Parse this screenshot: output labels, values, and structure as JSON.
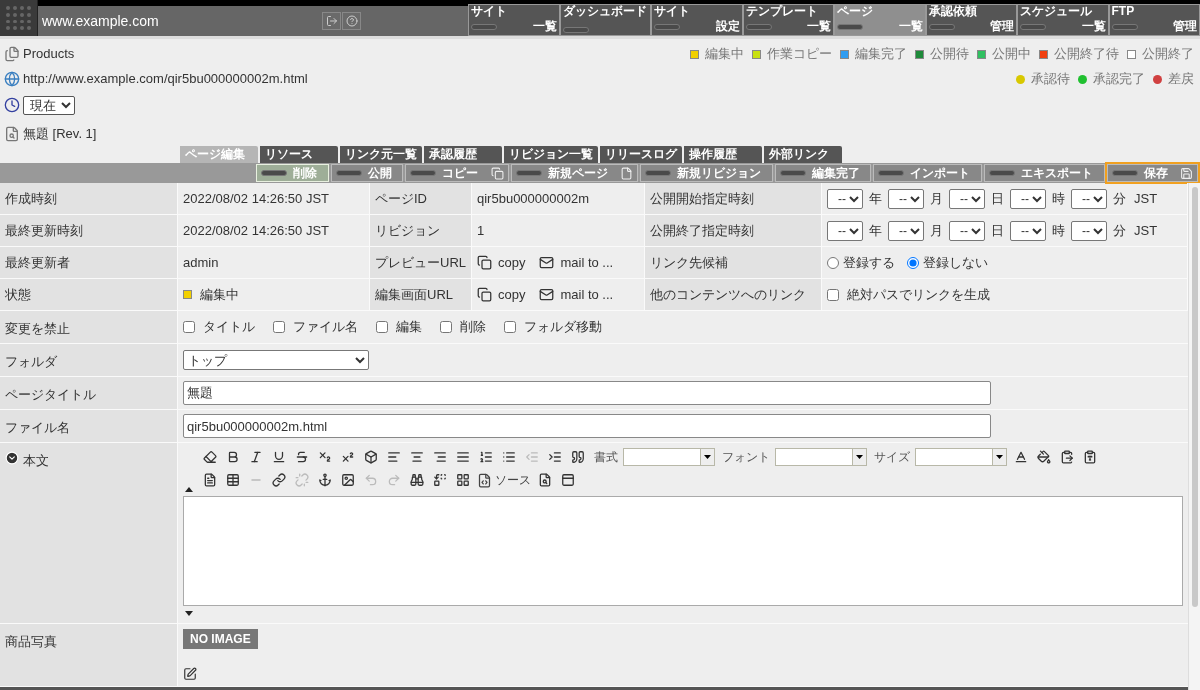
{
  "header": {
    "domain": "www.example.com"
  },
  "nav": [
    {
      "label": "サイト",
      "sub": "一覧",
      "selected": false
    },
    {
      "label": "ダッシュボード",
      "selected": false
    },
    {
      "label": "サイト",
      "sub": "設定",
      "selected": false
    },
    {
      "label": "テンプレート",
      "sub": "一覧",
      "selected": false
    },
    {
      "label": "ページ",
      "sub": "一覧",
      "selected": true
    },
    {
      "label": "承認依頼",
      "sub": "管理",
      "selected": false
    },
    {
      "label": "スケジュール",
      "sub": "一覧",
      "selected": false
    },
    {
      "label": "FTP",
      "sub": "管理",
      "selected": false
    }
  ],
  "page_info": {
    "title": "Products",
    "url": "http://www.example.com/qir5bu000000002m.html",
    "version": "現在",
    "revision": "無題 [Rev. 1]"
  },
  "status_legend": [
    {
      "label": "編集中",
      "color": "#f2d000"
    },
    {
      "label": "作業コピー",
      "color": "#c8e010"
    },
    {
      "label": "編集完了",
      "color": "#2f9cf0"
    },
    {
      "label": "公開待",
      "color": "#1e8a3a"
    },
    {
      "label": "公開中",
      "color": "#30c060"
    },
    {
      "label": "公開終了待",
      "color": "#f04010"
    },
    {
      "label": "公開終了",
      "color": "#ffffff"
    }
  ],
  "approval_legend": [
    {
      "label": "承認待",
      "color": "#d8c800"
    },
    {
      "label": "承認完了",
      "color": "#20c030"
    },
    {
      "label": "差戻",
      "color": "#d04040"
    }
  ],
  "tabs": [
    {
      "label": "ページ編集",
      "selected": true
    },
    {
      "label": "リソース",
      "selected": false
    },
    {
      "label": "リンク元一覧",
      "selected": false
    },
    {
      "label": "承認履歴",
      "selected": false
    },
    {
      "label": "リビジョン一覧",
      "selected": false
    },
    {
      "label": "リリースログ",
      "selected": false
    },
    {
      "label": "操作履歴",
      "selected": false
    },
    {
      "label": "外部リンク",
      "selected": false
    }
  ],
  "actions": [
    {
      "label": "削除",
      "kind": "plain",
      "selected": true,
      "focused": false
    },
    {
      "label": "公開",
      "kind": "plain",
      "selected": false,
      "focused": false
    },
    {
      "label": "コピー",
      "kind": "copy",
      "selected": false,
      "focused": false
    },
    {
      "label": "新規ページ",
      "kind": "new",
      "selected": false,
      "focused": false
    },
    {
      "label": "新規リビジョン",
      "kind": "plain",
      "selected": false,
      "focused": false
    },
    {
      "label": "編集完了",
      "kind": "plain",
      "selected": false,
      "focused": false
    },
    {
      "label": "インポート",
      "kind": "plain",
      "selected": false,
      "focused": false
    },
    {
      "label": "エキスポート",
      "kind": "plain",
      "selected": false,
      "focused": false
    },
    {
      "label": "保存",
      "kind": "save",
      "selected": false,
      "focused": true
    }
  ],
  "info_rows": [
    {
      "cells": [
        {
          "kind": "label",
          "text": "作成時刻"
        },
        {
          "kind": "text",
          "text": "2022/08/02 14:26:50 JST"
        },
        {
          "kind": "label",
          "text": "ページID"
        },
        {
          "kind": "text",
          "text": "qir5bu000000002m"
        },
        {
          "kind": "label",
          "text": "公開開始指定時刻"
        },
        {
          "kind": "datetime",
          "fields": [
            {
              "value": "--",
              "unit": "年"
            },
            {
              "value": "--",
              "unit": "月"
            },
            {
              "value": "--",
              "unit": "日"
            },
            {
              "value": "--",
              "unit": "時"
            },
            {
              "value": "--",
              "unit": "分"
            }
          ],
          "zone": "JST"
        }
      ]
    },
    {
      "cells": [
        {
          "kind": "label",
          "text": "最終更新時刻"
        },
        {
          "kind": "text",
          "text": "2022/08/02 14:26:50 JST"
        },
        {
          "kind": "label",
          "text": "リビジョン"
        },
        {
          "kind": "text",
          "text": "1"
        },
        {
          "kind": "label",
          "text": "公開終了指定時刻"
        },
        {
          "kind": "datetime",
          "fields": [
            {
              "value": "--",
              "unit": "年"
            },
            {
              "value": "--",
              "unit": "月"
            },
            {
              "value": "--",
              "unit": "日"
            },
            {
              "value": "--",
              "unit": "時"
            },
            {
              "value": "--",
              "unit": "分"
            }
          ],
          "zone": "JST"
        }
      ]
    },
    {
      "cells": [
        {
          "kind": "label",
          "text": "最終更新者"
        },
        {
          "kind": "text",
          "text": "admin"
        },
        {
          "kind": "label",
          "text": "プレビューURL"
        },
        {
          "kind": "links",
          "items": [
            {
              "kind": "copy",
              "label": "copy"
            },
            {
              "kind": "mail",
              "label": "mail to ..."
            }
          ]
        },
        {
          "kind": "label",
          "text": "リンク先候補"
        },
        {
          "kind": "radios",
          "options": [
            {
              "label": "登録する",
              "selected": false
            },
            {
              "label": "登録しない",
              "selected": true
            }
          ]
        }
      ]
    },
    {
      "cells": [
        {
          "kind": "label",
          "text": "状態"
        },
        {
          "kind": "status",
          "text": "編集中",
          "color": "#f2d000"
        },
        {
          "kind": "label",
          "text": "編集画面URL"
        },
        {
          "kind": "links",
          "items": [
            {
              "kind": "copy",
              "label": "copy"
            },
            {
              "kind": "mail",
              "label": "mail to ..."
            }
          ]
        },
        {
          "kind": "label",
          "text": "他のコンテンツへのリンク"
        },
        {
          "kind": "checkboxes",
          "options": [
            {
              "label": "絶対パスでリンクを生成",
              "checked": false
            }
          ]
        }
      ]
    }
  ],
  "form_rows": [
    {
      "label": "変更を禁止",
      "kind": "checkboxes",
      "options": [
        {
          "label": "タイトル",
          "checked": false
        },
        {
          "label": "ファイル名",
          "checked": false
        },
        {
          "label": "編集",
          "checked": false
        },
        {
          "label": "削除",
          "checked": false
        },
        {
          "label": "フォルダ移動",
          "checked": false
        }
      ]
    },
    {
      "label": "フォルダ",
      "kind": "select",
      "value": "トップ"
    },
    {
      "label": "ページタイトル",
      "kind": "input",
      "value": "無題"
    },
    {
      "label": "ファイル名",
      "kind": "input",
      "value": "qir5bu000000002m.html"
    },
    {
      "label": "本文",
      "kind": "editor",
      "expanded": true,
      "toolbar": [
        [
          {
            "kind": "button",
            "disabled": false
          },
          {
            "kind": "button",
            "disabled": false
          },
          {
            "kind": "button",
            "disabled": false
          },
          {
            "kind": "button",
            "disabled": false
          },
          {
            "kind": "button",
            "disabled": false
          },
          {
            "kind": "button",
            "disabled": false
          },
          {
            "kind": "button",
            "disabled": false
          },
          {
            "kind": "button",
            "disabled": false
          },
          {
            "kind": "button",
            "disabled": false
          },
          {
            "kind": "button",
            "disabled": false
          },
          {
            "kind": "button",
            "disabled": false
          },
          {
            "kind": "button",
            "disabled": false
          },
          {
            "kind": "button",
            "disabled": false
          },
          {
            "kind": "button",
            "disabled": false
          },
          {
            "kind": "button",
            "disabled": true
          },
          {
            "kind": "button",
            "disabled": false
          },
          {
            "kind": "button",
            "disabled": false
          },
          {
            "kind": "combo",
            "label": "書式"
          },
          {
            "kind": "combo",
            "label": "フォント"
          },
          {
            "kind": "combo",
            "label": "サイズ"
          },
          {
            "kind": "button",
            "disabled": false
          },
          {
            "kind": "button",
            "disabled": false
          },
          {
            "kind": "button",
            "disabled": false
          },
          {
            "kind": "button",
            "disabled": false
          }
        ],
        [
          {
            "kind": "button",
            "disabled": false
          },
          {
            "kind": "button",
            "disabled": false
          },
          {
            "kind": "button",
            "disabled": true
          },
          {
            "kind": "button",
            "disabled": false
          },
          {
            "kind": "button",
            "disabled": true
          },
          {
            "kind": "button",
            "disabled": false
          },
          {
            "kind": "button",
            "disabled": false
          },
          {
            "kind": "button",
            "disabled": true
          },
          {
            "kind": "button",
            "disabled": true
          },
          {
            "kind": "button",
            "disabled": false
          },
          {
            "kind": "button",
            "disabled": false
          },
          {
            "kind": "button",
            "disabled": false
          },
          {
            "kind": "labeled",
            "label": "ソース"
          },
          {
            "kind": "button",
            "disabled": false
          },
          {
            "kind": "button",
            "disabled": false
          }
        ]
      ]
    },
    {
      "label": "商品写真",
      "kind": "image",
      "placeholder": "NO IMAGE"
    }
  ]
}
